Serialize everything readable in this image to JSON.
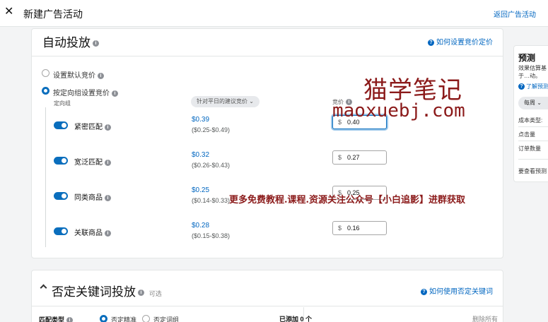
{
  "topbar": {
    "close": "✕",
    "title": "新建广告活动",
    "back": "返回广告活动"
  },
  "auto": {
    "title": "自动投放",
    "help": "如何设置竞价定价",
    "default_bid": "设置默认竞价",
    "group_bid": "按定向组设置竞价",
    "col_group": "定向组",
    "col_suggest": "针对平日的建议竞价",
    "col_bid": "竞价",
    "rows": [
      {
        "label": "紧密匹配",
        "suggest": "$0.39",
        "range": "($0.25-$0.49)",
        "currency": "$",
        "bid": "0.40"
      },
      {
        "label": "宽泛匹配",
        "suggest": "$0.32",
        "range": "($0.26-$0.43)",
        "currency": "$",
        "bid": "0.27"
      },
      {
        "label": "同类商品",
        "suggest": "$0.25",
        "range": "($0.14-$0.33)",
        "currency": "$",
        "bid": "0.25"
      },
      {
        "label": "关联商品",
        "suggest": "$0.28",
        "range": "($0.15-$0.38)",
        "currency": "$",
        "bid": "0.16"
      }
    ]
  },
  "negative": {
    "title": "否定关键词投放",
    "optional": "可选",
    "help": "如何使用否定关键词",
    "match_type": "匹配类型",
    "exact": "否定精准",
    "phrase": "否定词组",
    "added": "已添加 0 个",
    "remove_all": "删除所有"
  },
  "forecast": {
    "title": "预测",
    "desc": "效果估算基于…动。",
    "link": "了解预测",
    "period": "每周",
    "metric1": "成本类型:",
    "metric2": "点击量",
    "metric3": "订单数量",
    "more": "要查看预测"
  },
  "watermark": {
    "line1": "猫学笔记",
    "line2": "maoxuebj.com",
    "line3": "更多免费教程.课程.资源关注公众号【小白追影】进群获取"
  }
}
